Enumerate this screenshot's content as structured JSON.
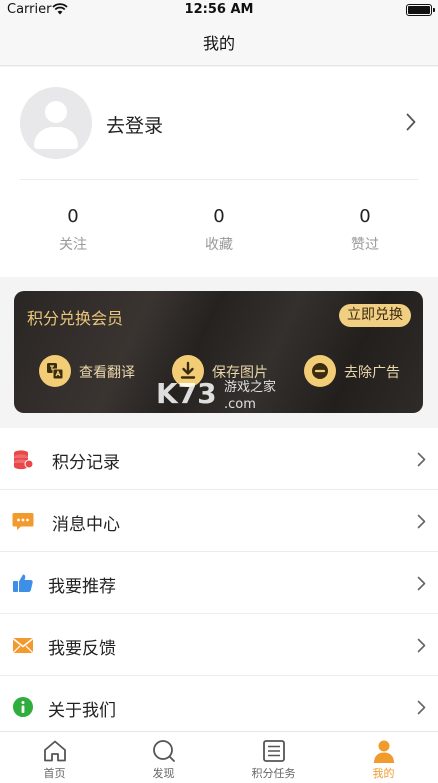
{
  "status_bar": {
    "carrier": "Carrier",
    "time": "12:56 AM"
  },
  "nav": {
    "title": "我的"
  },
  "profile": {
    "login_label": "去登录",
    "stats": [
      {
        "value": "0",
        "label": "关注"
      },
      {
        "value": "0",
        "label": "收藏"
      },
      {
        "value": "0",
        "label": "赞过"
      }
    ]
  },
  "vip_card": {
    "title": "积分兑换会员",
    "redeem_button": "立即兑换",
    "perks": [
      {
        "label": "查看翻译",
        "icon": "translate-icon"
      },
      {
        "label": "保存图片",
        "icon": "download-icon"
      },
      {
        "label": "去除广告",
        "icon": "remove-ads-icon"
      }
    ],
    "watermark": {
      "brand": "K73",
      "cn": "游戏之家",
      "domain": ".com"
    }
  },
  "menu": [
    {
      "label": "积分记录",
      "icon": "coins-icon",
      "color": "#e9474a"
    },
    {
      "label": "消息中心",
      "icon": "message-icon",
      "color": "#f39a2e"
    },
    {
      "label": "我要推荐",
      "icon": "thumbs-up-icon",
      "color": "#3d8fe8"
    },
    {
      "label": "我要反馈",
      "icon": "feedback-mail-icon",
      "color": "#f39a2e"
    },
    {
      "label": "关于我们",
      "icon": "info-icon",
      "color": "#2fae3e"
    }
  ],
  "tabs": [
    {
      "label": "首页",
      "icon": "home-icon",
      "active": false
    },
    {
      "label": "发现",
      "icon": "discover-icon",
      "active": false
    },
    {
      "label": "积分任务",
      "icon": "task-list-icon",
      "active": false
    },
    {
      "label": "我的",
      "icon": "profile-icon",
      "active": true
    }
  ],
  "colors": {
    "accent": "#f19b2c",
    "vip_gold": "#f0cf82",
    "vip_card_bg": "#2a2624"
  }
}
